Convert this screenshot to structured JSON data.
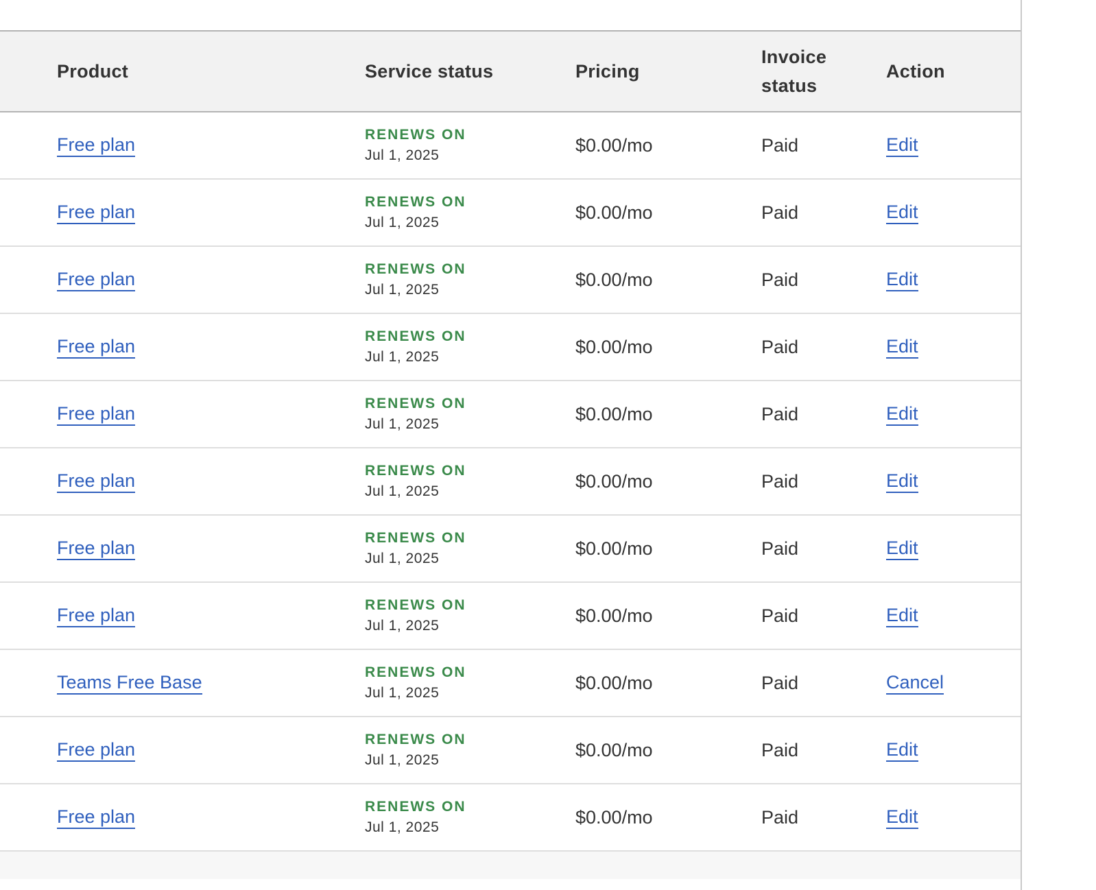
{
  "table": {
    "headers": {
      "product": "Product",
      "service_status": "Service status",
      "pricing": "Pricing",
      "invoice_status": "Invoice status",
      "action": "Action"
    },
    "rows": [
      {
        "product": "Free plan",
        "status_label": "RENEWS ON",
        "status_date": "Jul 1, 2025",
        "pricing": "$0.00/mo",
        "invoice": "Paid",
        "action": "Edit"
      },
      {
        "product": "Free plan",
        "status_label": "RENEWS ON",
        "status_date": "Jul 1, 2025",
        "pricing": "$0.00/mo",
        "invoice": "Paid",
        "action": "Edit"
      },
      {
        "product": "Free plan",
        "status_label": "RENEWS ON",
        "status_date": "Jul 1, 2025",
        "pricing": "$0.00/mo",
        "invoice": "Paid",
        "action": "Edit"
      },
      {
        "product": "Free plan",
        "status_label": "RENEWS ON",
        "status_date": "Jul 1, 2025",
        "pricing": "$0.00/mo",
        "invoice": "Paid",
        "action": "Edit"
      },
      {
        "product": "Free plan",
        "status_label": "RENEWS ON",
        "status_date": "Jul 1, 2025",
        "pricing": "$0.00/mo",
        "invoice": "Paid",
        "action": "Edit"
      },
      {
        "product": "Free plan",
        "status_label": "RENEWS ON",
        "status_date": "Jul 1, 2025",
        "pricing": "$0.00/mo",
        "invoice": "Paid",
        "action": "Edit"
      },
      {
        "product": "Free plan",
        "status_label": "RENEWS ON",
        "status_date": "Jul 1, 2025",
        "pricing": "$0.00/mo",
        "invoice": "Paid",
        "action": "Edit"
      },
      {
        "product": "Free plan",
        "status_label": "RENEWS ON",
        "status_date": "Jul 1, 2025",
        "pricing": "$0.00/mo",
        "invoice": "Paid",
        "action": "Edit"
      },
      {
        "product": "Teams Free Base",
        "status_label": "RENEWS ON",
        "status_date": "Jul 1, 2025",
        "pricing": "$0.00/mo",
        "invoice": "Paid",
        "action": "Cancel"
      },
      {
        "product": "Free plan",
        "status_label": "RENEWS ON",
        "status_date": "Jul 1, 2025",
        "pricing": "$0.00/mo",
        "invoice": "Paid",
        "action": "Edit"
      },
      {
        "product": "Free plan",
        "status_label": "RENEWS ON",
        "status_date": "Jul 1, 2025",
        "pricing": "$0.00/mo",
        "invoice": "Paid",
        "action": "Edit"
      }
    ]
  },
  "colors": {
    "link": "#2f5fbd",
    "renews": "#3a8a4a",
    "header_bg": "#f2f2f2"
  }
}
